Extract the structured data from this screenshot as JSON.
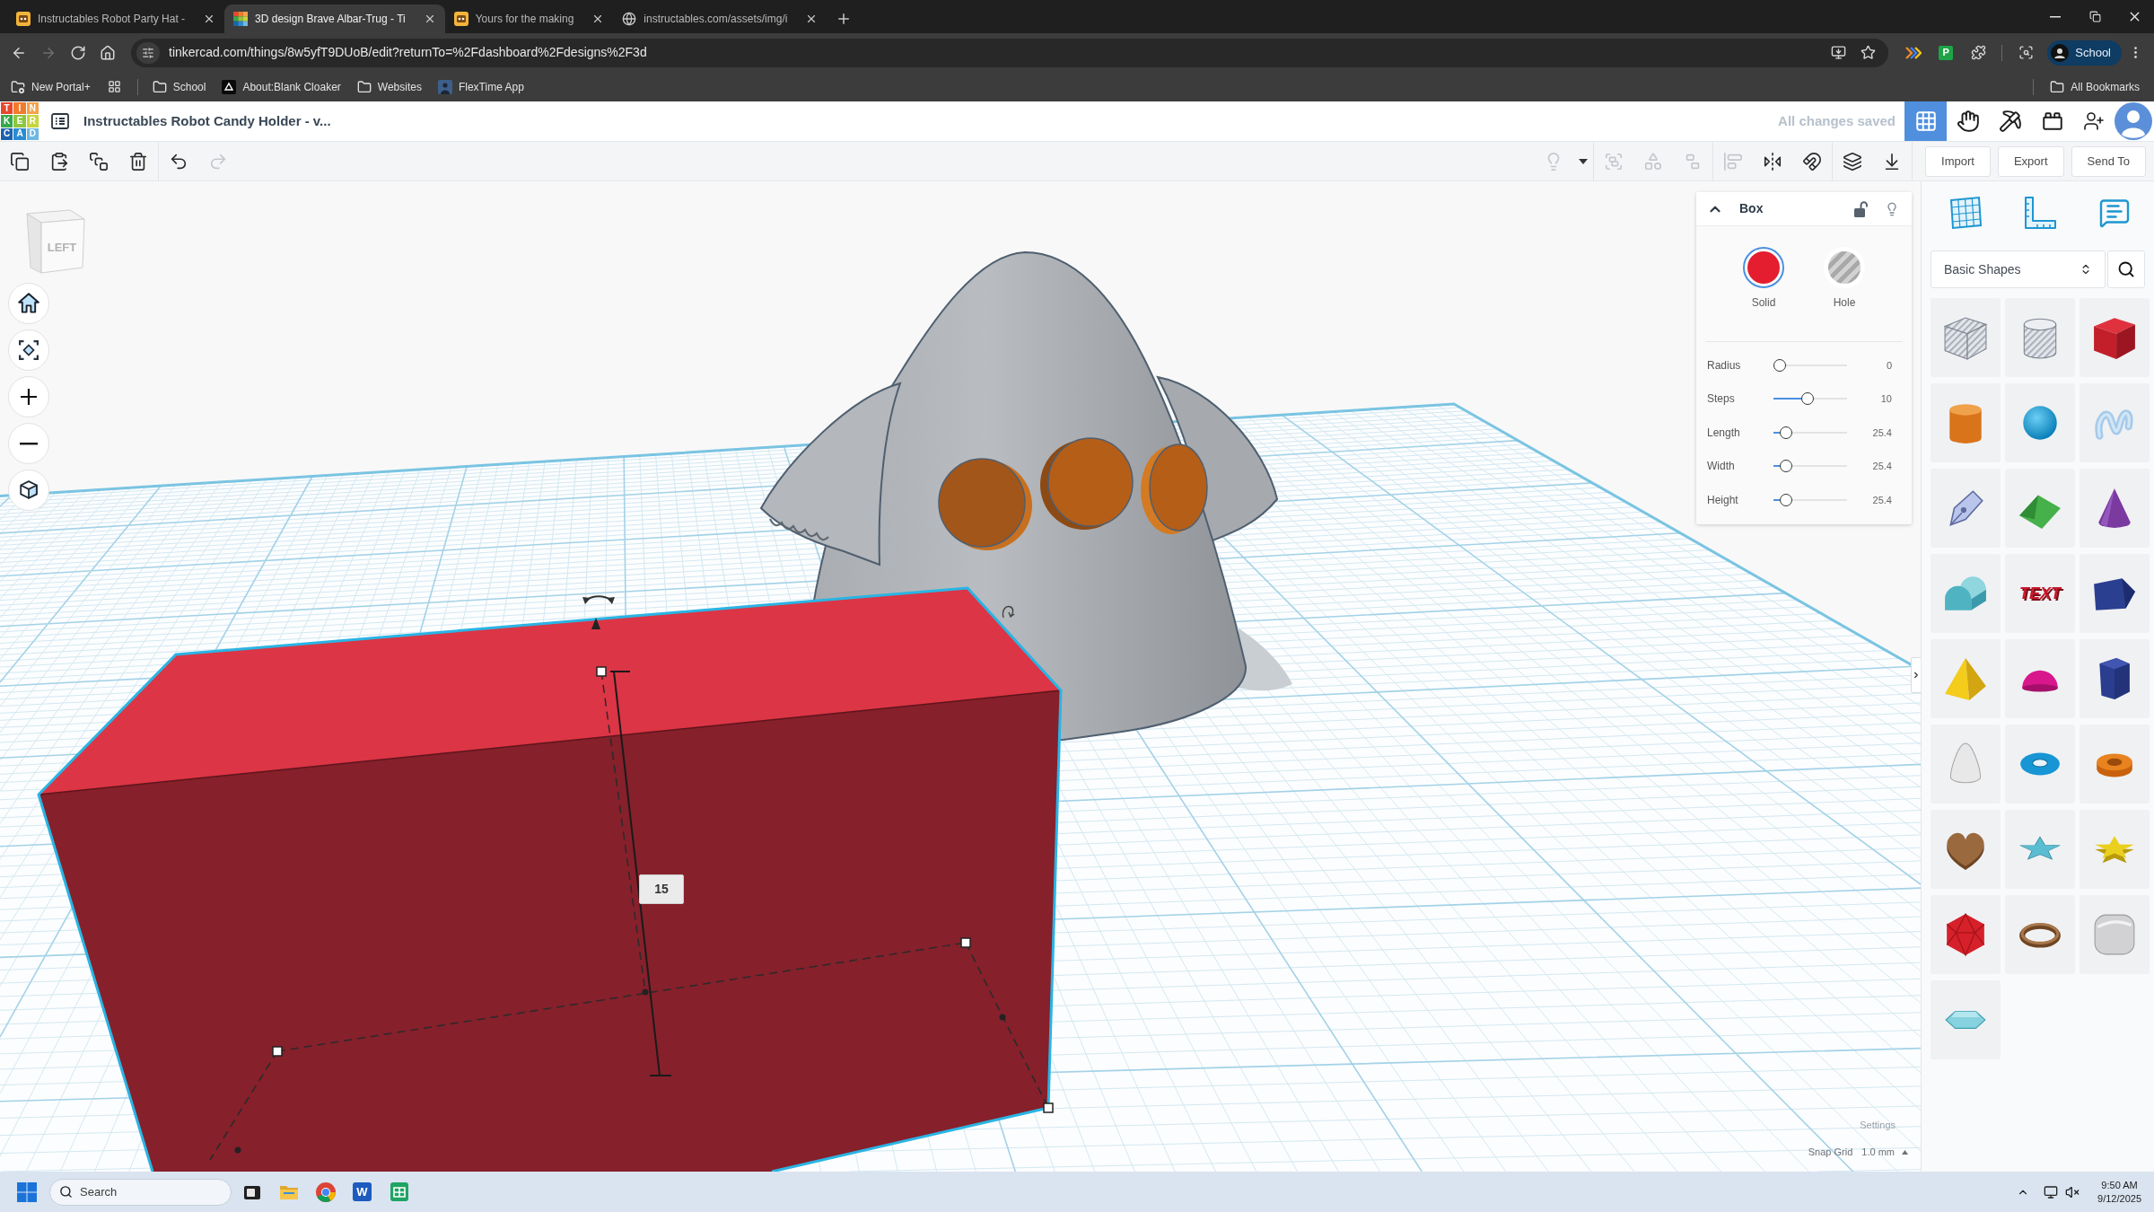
{
  "browser": {
    "tabs": [
      {
        "title": "Instructables Robot Party Hat -",
        "kind": "robot",
        "selected": false
      },
      {
        "title": "3D design Brave Albar-Trug - Ti",
        "kind": "blocks",
        "selected": true
      },
      {
        "title": "Yours for the making",
        "kind": "robot",
        "selected": false
      },
      {
        "title": "instructables.com/assets/img/i",
        "kind": "globe",
        "selected": false
      }
    ],
    "nav": [
      {
        "kind": "back",
        "disabled": false
      },
      {
        "kind": "forward",
        "disabled": true
      },
      {
        "kind": "reload",
        "disabled": false
      },
      {
        "kind": "home",
        "disabled": false
      }
    ],
    "url": "tinkercad.com/things/8w5yfT9DUoB/edit?returnTo=%2Fdashboard%2Fdesigns%2F3d",
    "extensions": [
      {
        "kind": "stripes"
      },
      {
        "kind": "letter",
        "letter": "P"
      },
      {
        "kind": "puzzle"
      }
    ],
    "profile": "School",
    "bookmarks": [
      {
        "kind": "folder_gear",
        "label": "New Portal+"
      },
      {
        "kind": "apps"
      },
      {
        "kind": "folder",
        "label": "School"
      },
      {
        "kind": "tile",
        "label": "About:Blank Cloaker"
      },
      {
        "kind": "folder",
        "label": "Websites"
      },
      {
        "kind": "image",
        "label": "FlexTime App"
      }
    ],
    "all_bookmarks": "All Bookmarks"
  },
  "editor": {
    "logo": [
      "T",
      "I",
      "N",
      "K",
      "E",
      "R",
      "C",
      "A",
      "D"
    ],
    "title": "Instructables Robot Candy Holder - v...",
    "save_status": "All changes saved",
    "modes": [
      {
        "kind": "grid",
        "selected": true
      },
      {
        "kind": "hand",
        "selected": false
      },
      {
        "kind": "pickaxe",
        "selected": false
      },
      {
        "kind": "brick",
        "selected": false
      }
    ]
  },
  "toolbar": {
    "left": [
      [
        {
          "kind": "copy",
          "disabled": false
        },
        {
          "kind": "paste",
          "disabled": false
        },
        {
          "kind": "duplicate",
          "disabled": false
        },
        {
          "kind": "delete",
          "disabled": false
        }
      ],
      [
        {
          "kind": "undo",
          "disabled": false
        },
        {
          "kind": "redo",
          "disabled": true
        }
      ]
    ],
    "right": [
      [
        {
          "kind": "bulb",
          "disabled": true
        },
        {
          "kind": "caret",
          "disabled": false
        }
      ],
      [
        {
          "kind": "group",
          "disabled": true
        },
        {
          "kind": "combine",
          "disabled": true
        },
        {
          "kind": "ungroup",
          "disabled": true
        }
      ],
      [
        {
          "kind": "align",
          "disabled": true
        },
        {
          "kind": "mirror",
          "disabled": false
        },
        {
          "kind": "magnet",
          "disabled": false
        }
      ],
      [
        {
          "kind": "workplane",
          "disabled": false
        },
        {
          "kind": "drop",
          "disabled": false
        }
      ]
    ],
    "buttons": [
      "Import",
      "Export",
      "Send To"
    ]
  },
  "view_cube": {
    "face": "LEFT"
  },
  "view_controls": [
    {
      "kind": "home"
    },
    {
      "kind": "fit"
    },
    {
      "kind": "zoom_in"
    },
    {
      "kind": "zoom_out"
    },
    {
      "kind": "perspective"
    }
  ],
  "scene": {
    "dimension": "15"
  },
  "inspector": {
    "title": "Box",
    "locked": false,
    "modes": [
      {
        "kind": "solid",
        "label": "Solid",
        "selected": true
      },
      {
        "kind": "hole",
        "label": "Hole",
        "selected": false
      }
    ],
    "params": [
      {
        "label": "Radius",
        "value": "0",
        "level": 0
      },
      {
        "label": "Steps",
        "value": "10",
        "level": 0.46
      },
      {
        "label": "Length",
        "value": "25.4",
        "level": 0.1
      },
      {
        "label": "Width",
        "value": "25.4",
        "level": 0.1
      },
      {
        "label": "Height",
        "value": "25.4",
        "level": 0.1
      }
    ]
  },
  "snap": {
    "settings": "Settings",
    "label": "Snap Grid",
    "value": "1.0 mm"
  },
  "library": {
    "tools": [
      {
        "kind": "workplane"
      },
      {
        "kind": "ruler"
      },
      {
        "kind": "notes"
      }
    ],
    "category": "Basic Shapes",
    "shapes": [
      {
        "kind": "striped_box"
      },
      {
        "kind": "striped_cylinder"
      },
      {
        "kind": "box"
      },
      {
        "kind": "cylinder"
      },
      {
        "kind": "sphere"
      },
      {
        "kind": "scribble"
      },
      {
        "kind": "pen"
      },
      {
        "kind": "roof"
      },
      {
        "kind": "cone"
      },
      {
        "kind": "round_roof"
      },
      {
        "kind": "text",
        "label": "TEXT"
      },
      {
        "kind": "polygon"
      },
      {
        "kind": "pyramid"
      },
      {
        "kind": "half_sphere"
      },
      {
        "kind": "hexagonal_prism"
      },
      {
        "kind": "paraboloid"
      },
      {
        "kind": "torus"
      },
      {
        "kind": "tube"
      },
      {
        "kind": "heart"
      },
      {
        "kind": "star"
      },
      {
        "kind": "star_extruded"
      },
      {
        "kind": "icosahedron"
      },
      {
        "kind": "ring"
      },
      {
        "kind": "rounded_box"
      },
      {
        "kind": "gem"
      }
    ]
  },
  "taskbar": {
    "search_placeholder": "Search",
    "apps": [
      {
        "kind": "taskview"
      },
      {
        "kind": "explorer"
      },
      {
        "kind": "browser"
      },
      {
        "kind": "word",
        "letter": "W"
      },
      {
        "kind": "sheets"
      }
    ],
    "time": "9:50 AM",
    "date": "9/12/2025"
  }
}
